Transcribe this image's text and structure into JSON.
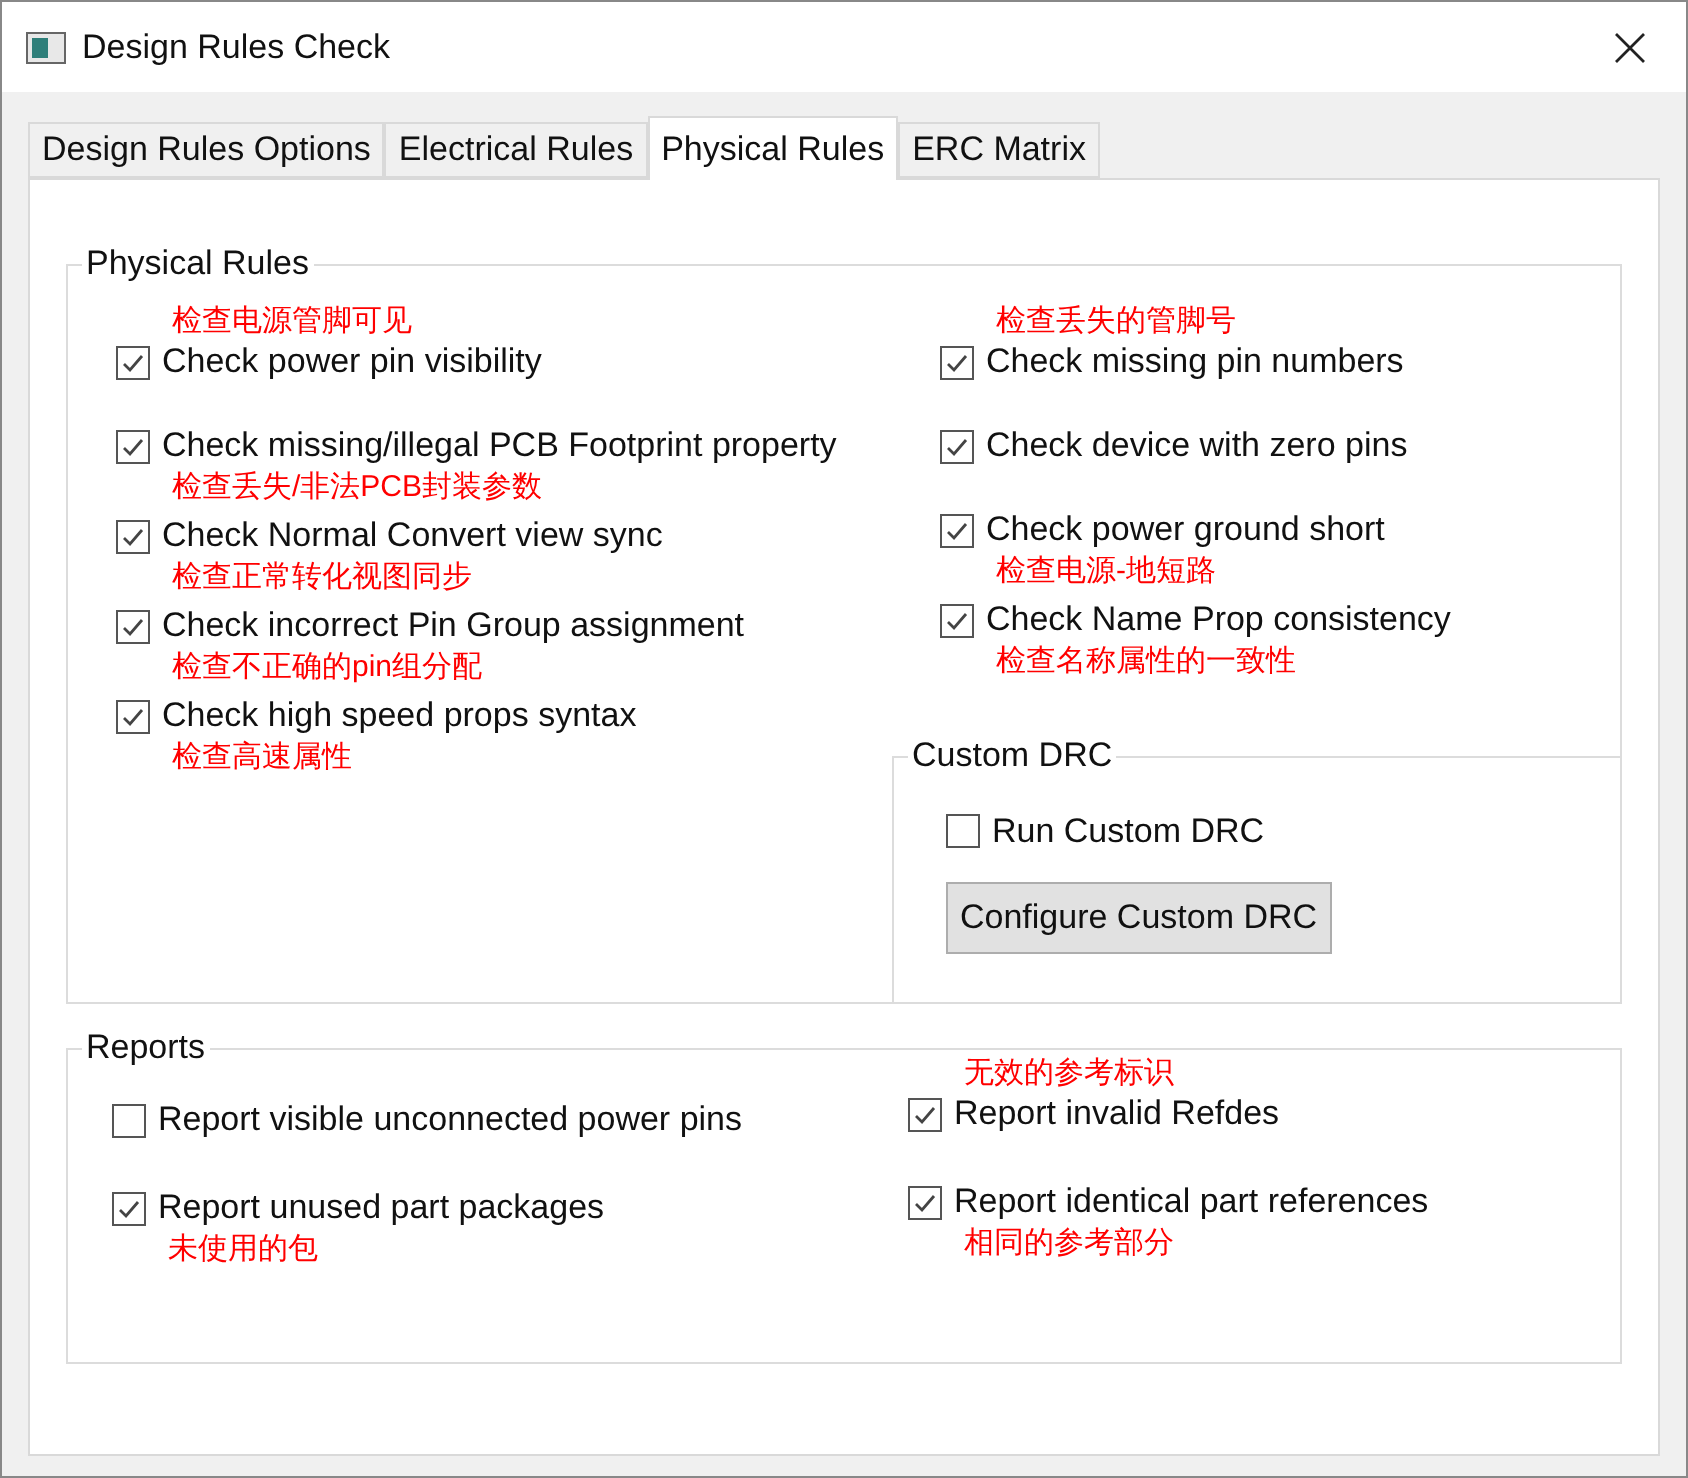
{
  "window": {
    "title": "Design Rules Check"
  },
  "tabs": [
    {
      "label": "Design Rules Options",
      "selected": false
    },
    {
      "label": "Electrical Rules",
      "selected": false
    },
    {
      "label": "Physical Rules",
      "selected": true
    },
    {
      "label": "ERC Matrix",
      "selected": false
    }
  ],
  "physical_rules": {
    "title": "Physical Rules",
    "left": [
      {
        "label": "Check power pin visibility",
        "checked": true,
        "note_above": "检查电源管脚可见"
      },
      {
        "label": "Check missing/illegal PCB Footprint property",
        "checked": true,
        "note_below": "检查丢失/非法PCB封装参数"
      },
      {
        "label": "Check Normal Convert view sync",
        "checked": true,
        "note_below": "检查正常转化视图同步"
      },
      {
        "label": "Check incorrect Pin Group assignment",
        "checked": true,
        "note_below": "检查不正确的pin组分配"
      },
      {
        "label": "Check high speed props syntax",
        "checked": true,
        "note_below": "检查高速属性"
      }
    ],
    "right": [
      {
        "label": "Check missing pin numbers",
        "checked": true,
        "note_above": "检查丢失的管脚号"
      },
      {
        "label": "Check device with zero pins",
        "checked": true
      },
      {
        "label": "Check power ground short",
        "checked": true,
        "note_below": "检查电源-地短路"
      },
      {
        "label": "Check Name Prop consistency",
        "checked": true,
        "note_below": "检查名称属性的一致性"
      }
    ],
    "custom_drc": {
      "title": "Custom DRC",
      "run": {
        "label": "Run Custom DRC",
        "checked": false
      },
      "button": "Configure Custom DRC"
    }
  },
  "reports": {
    "title": "Reports",
    "left": [
      {
        "label": "Report visible unconnected power pins",
        "checked": false
      },
      {
        "label": "Report unused part packages",
        "checked": true,
        "note_below": "未使用的包"
      }
    ],
    "right": [
      {
        "label": "Report invalid Refdes",
        "checked": true,
        "note_above": "无效的参考标识"
      },
      {
        "label": "Report identical part references",
        "checked": true,
        "note_below": "相同的参考部分"
      }
    ]
  }
}
